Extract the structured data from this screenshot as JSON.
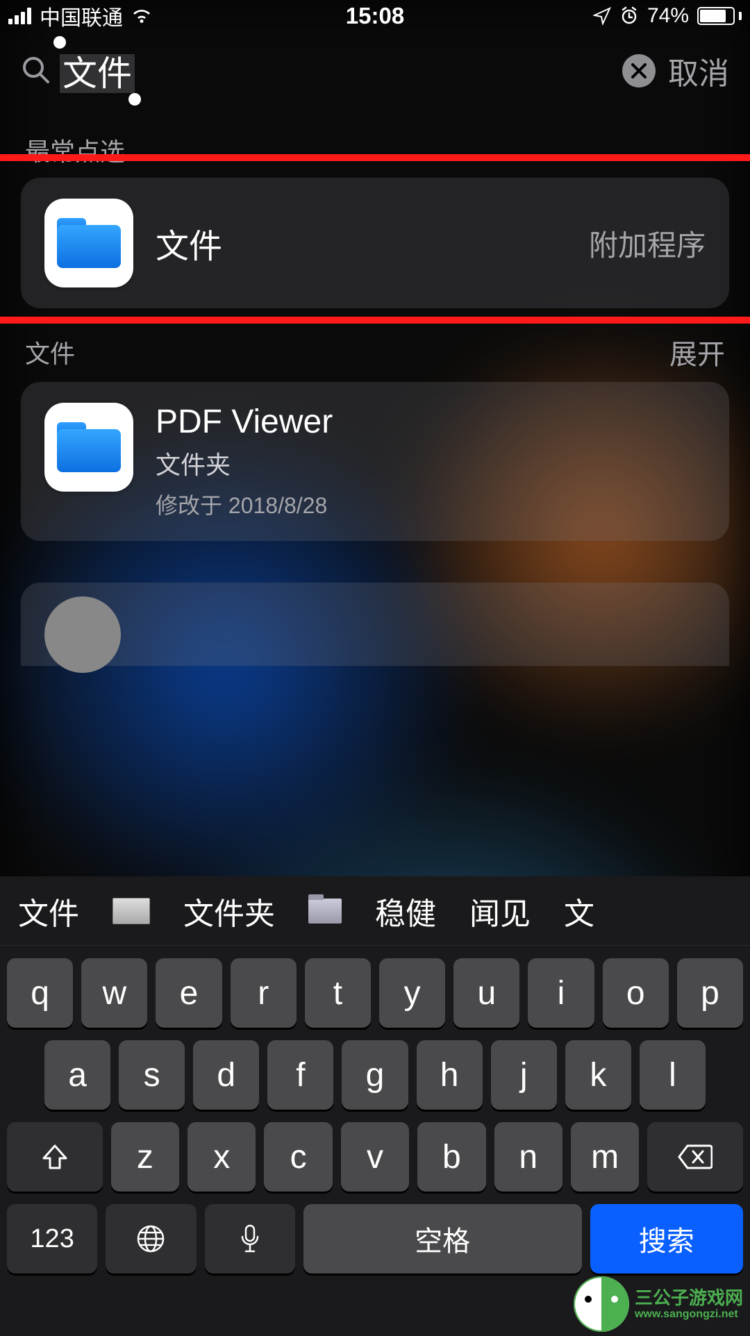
{
  "status": {
    "carrier": "中国联通",
    "time": "15:08",
    "battery_pct": "74%"
  },
  "search": {
    "query": "文件",
    "cancel": "取消"
  },
  "sections": {
    "top_hits": {
      "title": "最常点选",
      "items": [
        {
          "title": "文件",
          "category": "附加程序"
        }
      ]
    },
    "files": {
      "title": "文件",
      "action": "展开",
      "items": [
        {
          "title": "PDF Viewer",
          "subtitle": "文件夹",
          "meta": "修改于 2018/8/28"
        }
      ]
    }
  },
  "keyboard": {
    "candidates": [
      "文件",
      "文件夹",
      "稳健",
      "闻见",
      "文"
    ],
    "rows": {
      "r1": [
        "q",
        "w",
        "e",
        "r",
        "t",
        "y",
        "u",
        "i",
        "o",
        "p"
      ],
      "r2": [
        "a",
        "s",
        "d",
        "f",
        "g",
        "h",
        "j",
        "k",
        "l"
      ],
      "r3": [
        "z",
        "x",
        "c",
        "v",
        "b",
        "n",
        "m"
      ]
    },
    "numKey": "123",
    "space": "空格",
    "search": "搜索"
  },
  "watermark": {
    "name": "三公子游戏网",
    "url": "www.sangongzi.net"
  }
}
